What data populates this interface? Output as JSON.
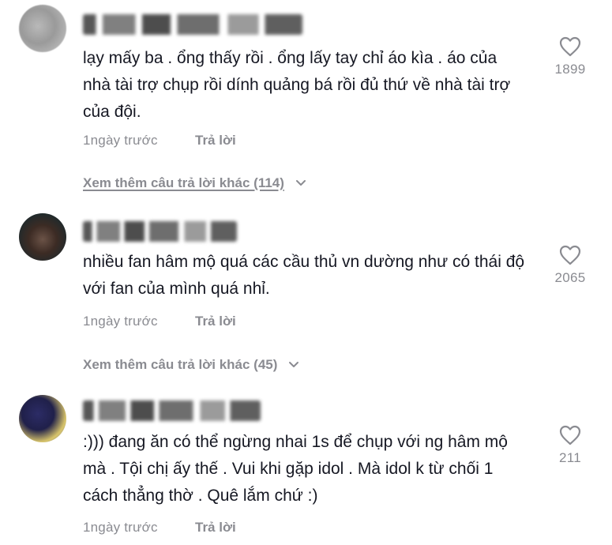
{
  "comments": [
    {
      "text": "lạy mấy ba . ổng thấy rồi . ổng lấy tay chỉ áo kìa . áo của nhà tài trợ chụp rồi dính quảng bá rồi đủ thứ về nhà tài trợ của đội.",
      "time": "1ngày trước",
      "reply_label": "Trả lời",
      "likes": "1899",
      "more_replies": "Xem thêm câu trả lời khác (114)"
    },
    {
      "text": "nhiều fan hâm mộ quá các cầu thủ vn dường như có thái độ với fan của mình quá nhỉ.",
      "time": "1ngày trước",
      "reply_label": "Trả lời",
      "likes": "2065",
      "more_replies": "Xem thêm câu trả lời khác (45)"
    },
    {
      "text": ":))) đang ăn có thể ngừng nhai 1s để chụp với ng hâm mộ mà . Tội chị ấy thế . Vui khi gặp idol . Mà idol k từ chối 1 cách thẳng thờ . Quê lắm chứ :)",
      "time": "1ngày trước",
      "reply_label": "Trả lời",
      "likes": "211"
    }
  ]
}
